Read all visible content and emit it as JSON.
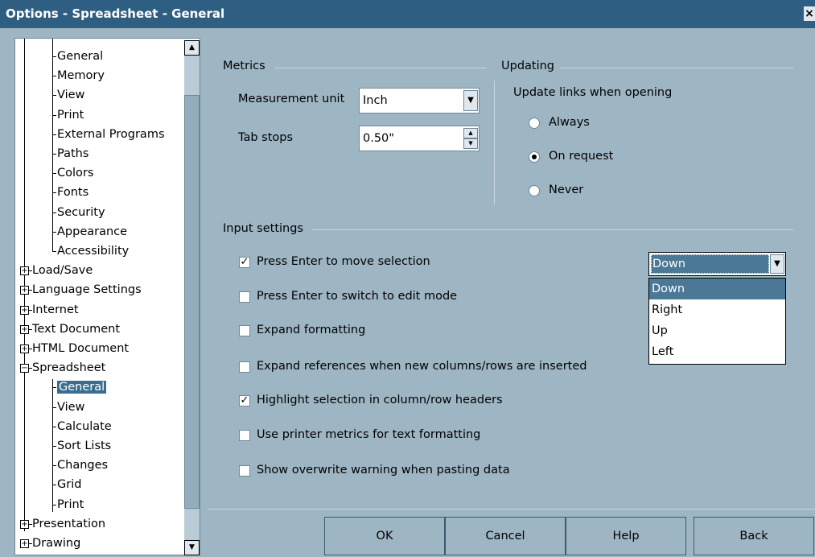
{
  "window": {
    "title": "Options - Spreadsheet - General",
    "close_glyph": "×"
  },
  "tree": {
    "items": [
      {
        "label": "General",
        "level": 2
      },
      {
        "label": "Memory",
        "level": 2
      },
      {
        "label": "View",
        "level": 2
      },
      {
        "label": "Print",
        "level": 2
      },
      {
        "label": "External Programs",
        "level": 2
      },
      {
        "label": "Paths",
        "level": 2
      },
      {
        "label": "Colors",
        "level": 2
      },
      {
        "label": "Fonts",
        "level": 2
      },
      {
        "label": "Security",
        "level": 2
      },
      {
        "label": "Appearance",
        "level": 2
      },
      {
        "label": "Accessibility",
        "level": 2
      },
      {
        "label": "Load/Save",
        "level": 1,
        "expander": "+"
      },
      {
        "label": "Language Settings",
        "level": 1,
        "expander": "+"
      },
      {
        "label": "Internet",
        "level": 1,
        "expander": "+"
      },
      {
        "label": "Text Document",
        "level": 1,
        "expander": "+"
      },
      {
        "label": "HTML Document",
        "level": 1,
        "expander": "+"
      },
      {
        "label": "Spreadsheet",
        "level": 1,
        "expander": "−"
      },
      {
        "label": "General",
        "level": 2,
        "selected": true
      },
      {
        "label": "View",
        "level": 2
      },
      {
        "label": "Calculate",
        "level": 2
      },
      {
        "label": "Sort Lists",
        "level": 2
      },
      {
        "label": "Changes",
        "level": 2
      },
      {
        "label": "Grid",
        "level": 2
      },
      {
        "label": "Print",
        "level": 2
      },
      {
        "label": "Presentation",
        "level": 1,
        "expander": "+"
      },
      {
        "label": "Drawing",
        "level": 1,
        "expander": "+"
      }
    ]
  },
  "metrics": {
    "heading": "Metrics",
    "measurement_unit_label": "Measurement unit",
    "measurement_unit_value": "Inch",
    "tab_stops_label": "Tab stops",
    "tab_stops_value": "0.50\""
  },
  "updating": {
    "heading": "Updating",
    "prompt": "Update links when opening",
    "options": [
      "Always",
      "On request",
      "Never"
    ],
    "selected": "On request"
  },
  "input_settings": {
    "heading": "Input settings",
    "checks": [
      {
        "label": "Press Enter to move selection",
        "checked": true
      },
      {
        "label": "Press Enter to switch to edit mode",
        "checked": false
      },
      {
        "label": "Expand formatting",
        "checked": false
      },
      {
        "label": "Expand references when new columns/rows are inserted",
        "checked": false
      },
      {
        "label": "Highlight selection in column/row headers",
        "checked": true
      },
      {
        "label": "Use printer metrics for text formatting",
        "checked": false
      },
      {
        "label": "Show overwrite warning when pasting data",
        "checked": false
      }
    ],
    "direction_value": "Down",
    "direction_options": [
      "Down",
      "Right",
      "Up",
      "Left"
    ]
  },
  "buttons": {
    "ok": "OK",
    "cancel": "Cancel",
    "help": "Help",
    "back": "Back"
  }
}
